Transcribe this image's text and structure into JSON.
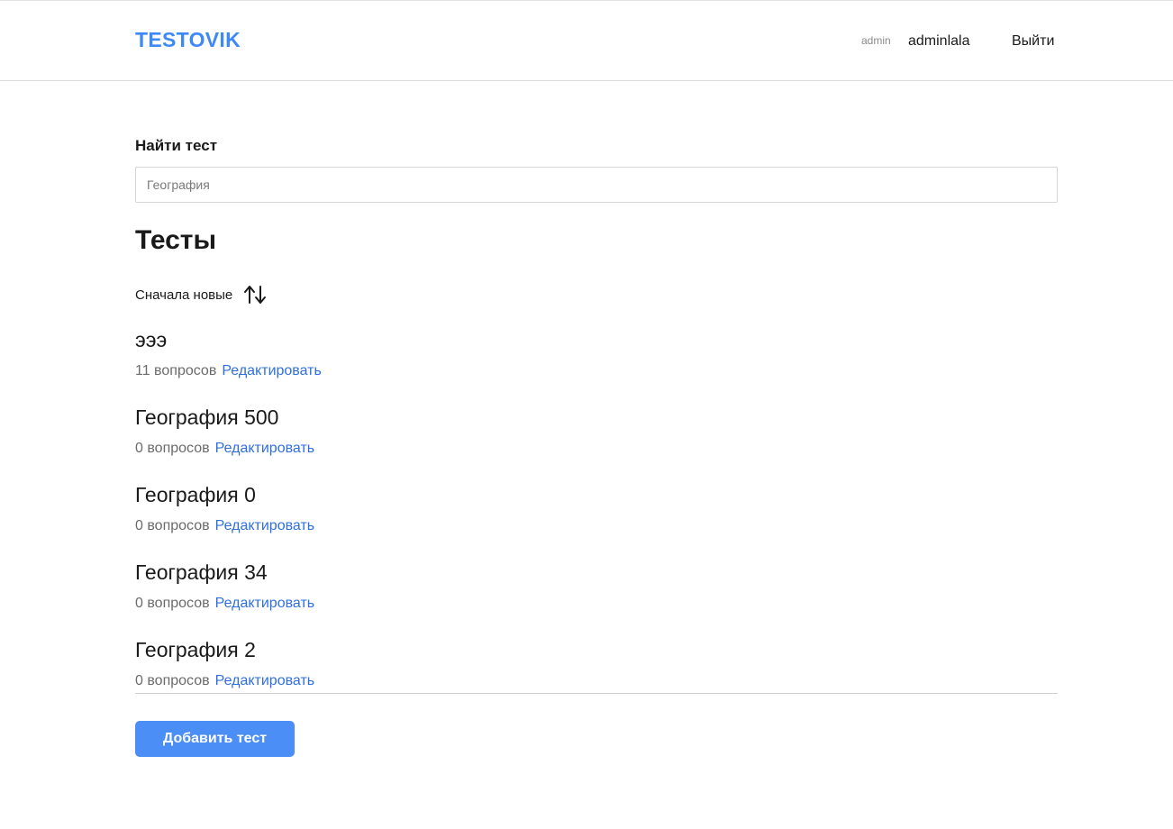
{
  "header": {
    "logo": "TESTOVIK",
    "role": "admin",
    "username": "adminlala",
    "logout_label": "Выйти"
  },
  "search": {
    "label": "Найти тест",
    "placeholder": "География"
  },
  "main": {
    "title": "Тесты",
    "sort_label": "Сначала новые",
    "sort_icon": "sort-arrows-icon",
    "tests": [
      {
        "title": "эээ",
        "count": "11 вопросов",
        "edit_label": "Редактировать"
      },
      {
        "title": "География 500",
        "count": "0 вопросов",
        "edit_label": "Редактировать"
      },
      {
        "title": "География 0",
        "count": "0 вопросов",
        "edit_label": "Редактировать"
      },
      {
        "title": "География 34",
        "count": "0 вопросов",
        "edit_label": "Редактировать"
      },
      {
        "title": "География 2",
        "count": "0 вопросов",
        "edit_label": "Редактировать"
      }
    ],
    "add_button_label": "Добавить тест"
  },
  "colors": {
    "brand": "#3d8af7",
    "link": "#2f6fe0",
    "button": "#4b8ef5"
  }
}
